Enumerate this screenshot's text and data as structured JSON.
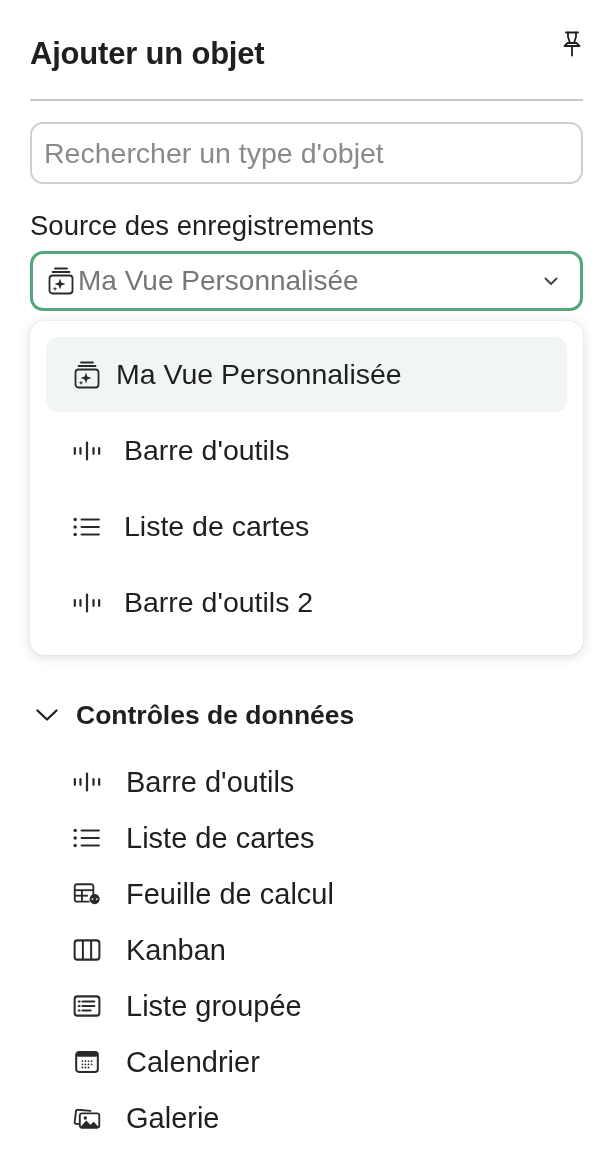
{
  "header": {
    "title": "Ajouter un objet"
  },
  "search": {
    "placeholder": "Rechercher un type d'objet"
  },
  "source": {
    "label": "Source des enregistrements",
    "value": "Ma Vue Personnalisée",
    "kind": "view",
    "expanded": true,
    "options": [
      {
        "label": "Ma Vue Personnalisée",
        "kind": "view",
        "selected": true
      },
      {
        "label": "Barre d'outils",
        "kind": "toolbar",
        "selected": false
      },
      {
        "label": "Liste de cartes",
        "kind": "list",
        "selected": false
      },
      {
        "label": "Barre d'outils 2",
        "kind": "toolbar",
        "selected": false
      }
    ]
  },
  "sections": [
    {
      "title": "Contrôles de données",
      "expanded": true,
      "items": [
        {
          "label": "Barre d'outils",
          "kind": "toolbar"
        },
        {
          "label": "Liste de cartes",
          "kind": "list"
        },
        {
          "label": "Feuille de calcul",
          "kind": "sheet"
        },
        {
          "label": "Kanban",
          "kind": "kanban"
        },
        {
          "label": "Liste groupée",
          "kind": "grouped"
        },
        {
          "label": "Calendrier",
          "kind": "calendar"
        },
        {
          "label": "Galerie",
          "kind": "gallery"
        }
      ]
    }
  ]
}
